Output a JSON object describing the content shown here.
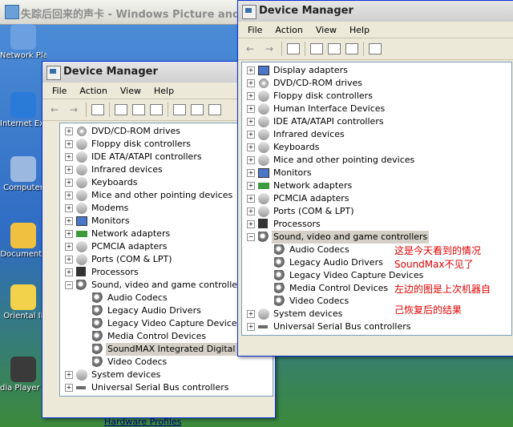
{
  "background_window": {
    "title": "失踪后回来的声卡 - Windows Picture and"
  },
  "desktop": {
    "icons": [
      {
        "label": "Network Places",
        "color": "#6aa0e0"
      },
      {
        "label": "Internet Explorer",
        "color": "#2a7ad8"
      },
      {
        "label": "Computer",
        "color": "#9ab8e0"
      },
      {
        "label": "Documents",
        "color": "#f0c040"
      },
      {
        "label": "Oriental II",
        "color": "#f2d24a"
      },
      {
        "label": "dia Player Classic",
        "color": "#3a3a3a"
      }
    ]
  },
  "left_window": {
    "title": "Device Manager",
    "menu": [
      "File",
      "Action",
      "View",
      "Help"
    ],
    "tree": [
      {
        "label": "DVD/CD-ROM drives",
        "level": 0,
        "icon": "cd-icon"
      },
      {
        "label": "Floppy disk controllers",
        "level": 0,
        "icon": "floppy-icon"
      },
      {
        "label": "IDE ATA/ATAPI controllers",
        "level": 0,
        "icon": "ide-icon"
      },
      {
        "label": "Infrared devices",
        "level": 0,
        "icon": "infrared-icon"
      },
      {
        "label": "Keyboards",
        "level": 0,
        "icon": "keyboard-icon"
      },
      {
        "label": "Mice and other pointing devices",
        "level": 0,
        "icon": "mouse-icon"
      },
      {
        "label": "Modems",
        "level": 0,
        "icon": "modem-icon"
      },
      {
        "label": "Monitors",
        "level": 0,
        "icon": "monitor-icon"
      },
      {
        "label": "Network adapters",
        "level": 0,
        "icon": "network-icon"
      },
      {
        "label": "PCMCIA adapters",
        "level": 0,
        "icon": "pcmcia-icon"
      },
      {
        "label": "Ports (COM & LPT)",
        "level": 0,
        "icon": "port-icon"
      },
      {
        "label": "Processors",
        "level": 0,
        "icon": "processor-icon"
      },
      {
        "label": "Sound, video and game controllers",
        "level": 0,
        "expanded": true,
        "icon": "speaker-icon"
      },
      {
        "label": "Audio Codecs",
        "level": 1,
        "icon": "speaker-icon"
      },
      {
        "label": "Legacy Audio Drivers",
        "level": 1,
        "icon": "speaker-icon"
      },
      {
        "label": "Legacy Video Capture Devices",
        "level": 1,
        "icon": "speaker-icon"
      },
      {
        "label": "Media Control Devices",
        "level": 1,
        "icon": "speaker-icon"
      },
      {
        "label": "SoundMAX Integrated Digital Aud",
        "level": 1,
        "icon": "speaker-icon",
        "selected": true
      },
      {
        "label": "Video Codecs",
        "level": 1,
        "icon": "speaker-icon"
      },
      {
        "label": "System devices",
        "level": 0,
        "icon": "system-icon"
      },
      {
        "label": "Universal Serial Bus controllers",
        "level": 0,
        "icon": "usb-icon"
      }
    ],
    "below_link": "Hardware Profiles"
  },
  "right_window": {
    "title": "Device Manager",
    "menu": [
      "File",
      "Action",
      "View",
      "Help"
    ],
    "tree": [
      {
        "label": "Display adapters",
        "level": 0,
        "icon": "display-icon"
      },
      {
        "label": "DVD/CD-ROM drives",
        "level": 0,
        "icon": "cd-icon"
      },
      {
        "label": "Floppy disk controllers",
        "level": 0,
        "icon": "floppy-icon"
      },
      {
        "label": "Human Interface Devices",
        "level": 0,
        "icon": "hid-icon"
      },
      {
        "label": "IDE ATA/ATAPI controllers",
        "level": 0,
        "icon": "ide-icon"
      },
      {
        "label": "Infrared devices",
        "level": 0,
        "icon": "infrared-icon"
      },
      {
        "label": "Keyboards",
        "level": 0,
        "icon": "keyboard-icon"
      },
      {
        "label": "Mice and other pointing devices",
        "level": 0,
        "icon": "mouse-icon"
      },
      {
        "label": "Monitors",
        "level": 0,
        "icon": "monitor-icon"
      },
      {
        "label": "Network adapters",
        "level": 0,
        "icon": "network-icon"
      },
      {
        "label": "PCMCIA adapters",
        "level": 0,
        "icon": "pcmcia-icon"
      },
      {
        "label": "Ports (COM & LPT)",
        "level": 0,
        "icon": "port-icon"
      },
      {
        "label": "Processors",
        "level": 0,
        "icon": "processor-icon"
      },
      {
        "label": "Sound, video and game controllers",
        "level": 0,
        "expanded": true,
        "icon": "speaker-icon",
        "selected": true
      },
      {
        "label": "Audio Codecs",
        "level": 1,
        "icon": "speaker-icon"
      },
      {
        "label": "Legacy Audio Drivers",
        "level": 1,
        "icon": "speaker-icon"
      },
      {
        "label": "Legacy Video Capture Devices",
        "level": 1,
        "icon": "speaker-icon"
      },
      {
        "label": "Media Control Devices",
        "level": 1,
        "icon": "speaker-icon"
      },
      {
        "label": "Video Codecs",
        "level": 1,
        "icon": "speaker-icon"
      },
      {
        "label": "System devices",
        "level": 0,
        "icon": "system-icon"
      },
      {
        "label": "Universal Serial Bus controllers",
        "level": 0,
        "icon": "usb-icon"
      }
    ]
  },
  "annotations": [
    "这是今天看到的情况",
    "SoundMax不见了",
    "左边的图是上次机器自",
    "己恢复后的结果"
  ],
  "colors": {
    "annotation": "#e00000",
    "titlebar_active": "#0058ee"
  }
}
